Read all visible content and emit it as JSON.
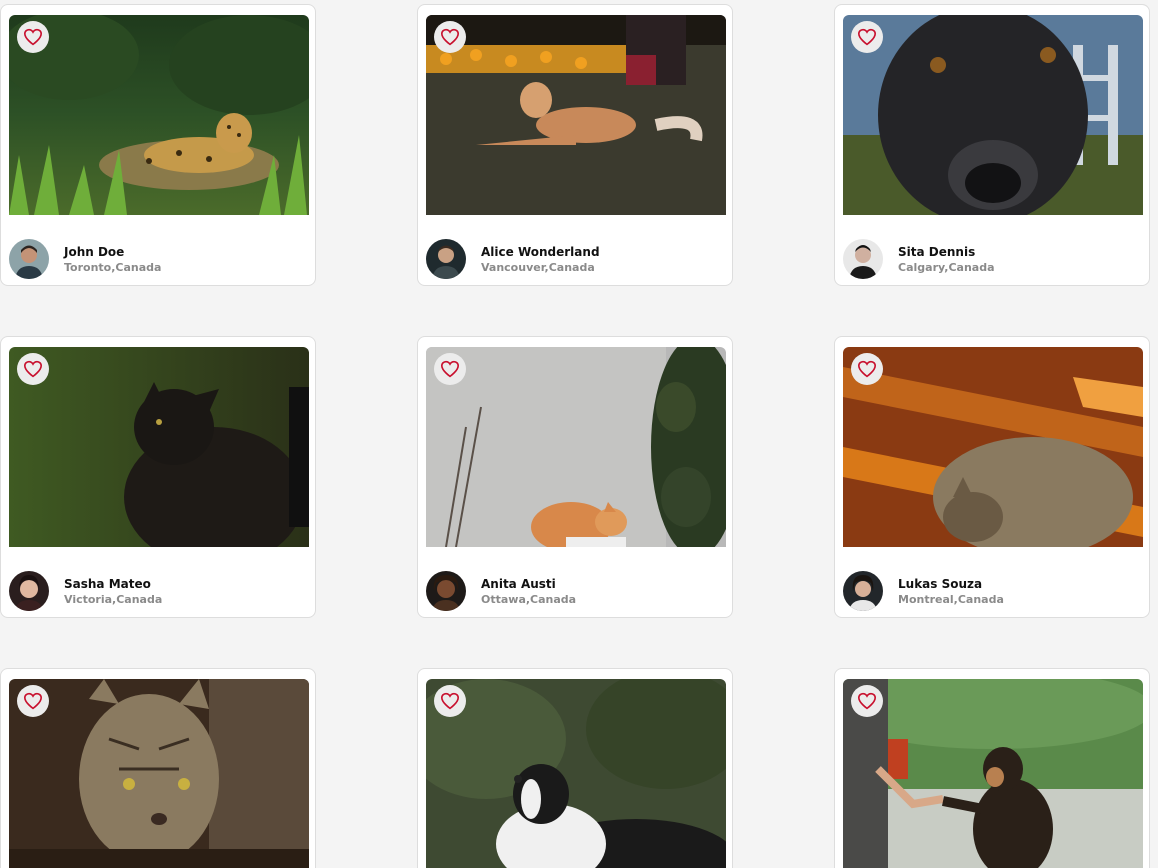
{
  "colors": {
    "page_background": "#f4f4f4",
    "card_background": "#ffffff",
    "heart_accent": "#c8102e",
    "name_text": "#111111",
    "location_text": "#8a8a8a"
  },
  "cards": [
    {
      "photo": "jaguar lying in grass",
      "owner": "John Doe",
      "location": "Toronto,Canada"
    },
    {
      "photo": "tan dog lying on lawn",
      "owner": "Alice Wonderland",
      "location": "Vancouver,Canada"
    },
    {
      "photo": "black dog close-up",
      "owner": "Sita Dennis",
      "location": "Calgary,Canada"
    },
    {
      "photo": "black long-haired cat",
      "owner": "Sasha Mateo",
      "location": "Victoria,Canada"
    },
    {
      "photo": "orange cat by white wall",
      "owner": "Anita Austi",
      "location": "Ottawa,Canada"
    },
    {
      "photo": "tabby cat in sunlight",
      "owner": "Lukas Souza",
      "location": "Montreal,Canada"
    },
    {
      "photo": "tabby cat drinking",
      "owner": "",
      "location": ""
    },
    {
      "photo": "border collie looking up",
      "owner": "",
      "location": ""
    },
    {
      "photo": "dog giving paw",
      "owner": "",
      "location": ""
    }
  ],
  "icons": {
    "like": "heart-icon",
    "avatar": "avatar"
  }
}
